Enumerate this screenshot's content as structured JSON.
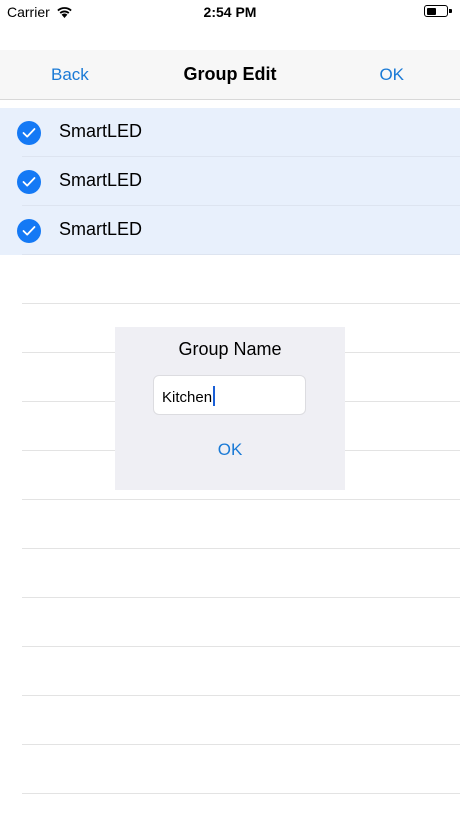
{
  "status_bar": {
    "carrier": "Carrier",
    "time": "2:54 PM"
  },
  "nav": {
    "back_label": "Back",
    "title": "Group Edit",
    "ok_label": "OK"
  },
  "devices": [
    {
      "name": "SmartLED",
      "selected": true
    },
    {
      "name": "SmartLED",
      "selected": true
    },
    {
      "name": "SmartLED",
      "selected": true
    }
  ],
  "empty_rows": 11,
  "dialog": {
    "title": "Group Name",
    "input_value": "Kitchen",
    "ok_label": "OK"
  },
  "colors": {
    "accent": "#1a7ad6",
    "check": "#1479f5",
    "selected_row": "#e8f0fc"
  },
  "icons": {
    "wifi": "wifi-icon",
    "battery": "battery-icon",
    "check": "checkmark-icon"
  }
}
